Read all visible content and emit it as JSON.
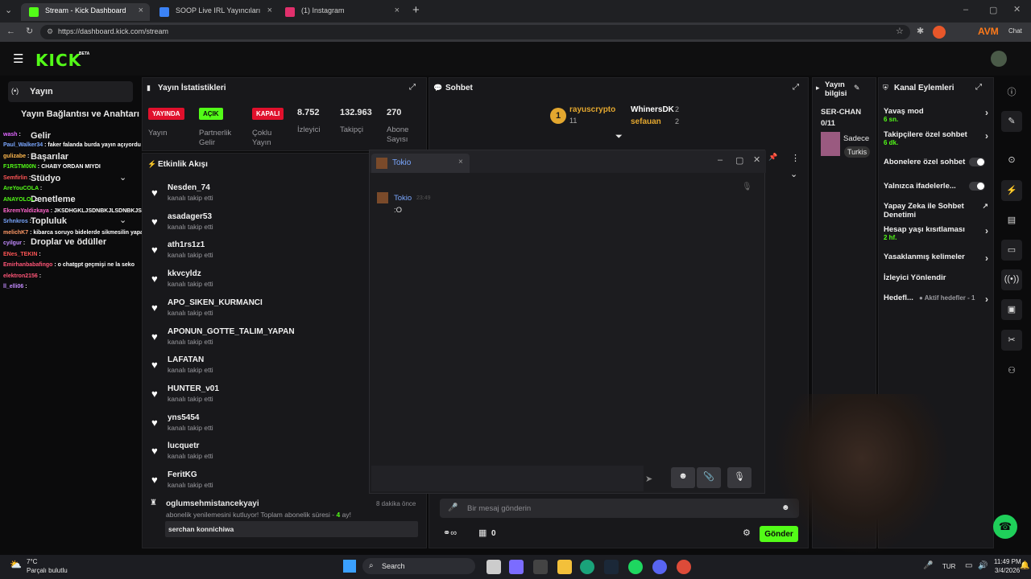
{
  "browser": {
    "tabs": [
      {
        "title": "Stream - Kick Dashboard",
        "color": "#53fc18",
        "active": true
      },
      {
        "title": "SOOP Live IRL Yayıncıları",
        "color": "#3b82f6",
        "active": false
      },
      {
        "title": "(1) Instagram",
        "color": "#e1306c",
        "active": false
      }
    ],
    "url": "https://dashboard.kick.com/stream",
    "ext_label": "AVM",
    "chat_label": "Chat"
  },
  "site": {
    "logo": "KICK",
    "logo_sup": "BETA"
  },
  "sidebar": {
    "title": "Yayın",
    "items": [
      "Yayın Bağlantısı ve Anahtarı",
      "Gelir",
      "Başarılar",
      "Stüdyo",
      "Denetleme",
      "Topluluk",
      "Droplar ve ödüller"
    ]
  },
  "overlay_chat": [
    {
      "user": "wash",
      "msg": "",
      "color": "#e066ff"
    },
    {
      "user": "Paul_Walker34",
      "msg": "faker falanda burda yayın açıyordu galiba",
      "color": "#7aa7ff"
    },
    {
      "user": "gulizabe",
      "msg": "",
      "color": "#ffb84d"
    },
    {
      "user": "F1RSTM00N",
      "msg": "CHABY ORDAN MIYDI",
      "color": "#53fc18"
    },
    {
      "user": "Semfirlin",
      "msg": "",
      "color": "#ff5555"
    },
    {
      "user": "AreYouCOLA",
      "msg": "",
      "color": "#53fc18"
    },
    {
      "user": "ANAYOLOL",
      "msg": "",
      "color": "#53fc18"
    },
    {
      "user": "EkremYaldizkaya",
      "msg": "JKSDHGKLJSDNBKJLSDNBKJSDBNSDKB",
      "color": "#ff66cc"
    },
    {
      "user": "Srhnkros",
      "msg": "",
      "color": "#7aa7ff"
    },
    {
      "user": "melichK7",
      "msg": "kibarca soruyo bidelerde sikmesilin yapay zeka diyerr",
      "color": "#ff9966"
    },
    {
      "user": "cyilgur",
      "msg": "",
      "color": "#c38bff"
    },
    {
      "user": "ENes_TEKIN",
      "msg": "",
      "color": "#ff5555"
    },
    {
      "user": "Emirhanbabafingo",
      "msg": "o chatgpt geçmişi ne la seko",
      "color": "#ff5577"
    },
    {
      "user": "elektron2156",
      "msg": "",
      "color": "#ff5577"
    },
    {
      "user": "ll_elli06",
      "msg": "",
      "color": "#c38bff"
    }
  ],
  "stats": {
    "title": "Yayın İstatistikleri",
    "items": [
      {
        "value": "YAYINDA",
        "label": "Yayın",
        "color": "#e0102c"
      },
      {
        "value": "AÇIK",
        "label": "Partnerlik Gelir",
        "color": "#53fc18"
      },
      {
        "value": "KAPALI",
        "label": "Çoklu Yayın",
        "color": "#e0102c"
      },
      {
        "value": "8.752",
        "label": "İzleyici"
      },
      {
        "value": "132.963",
        "label": "Takipçi"
      },
      {
        "value": "270",
        "label": "Abone Sayısı"
      }
    ]
  },
  "activity": {
    "title": "Etkinlik Akışı",
    "sub": "kanalı takip etti",
    "follows": [
      "Nesden_74",
      "asadager53",
      "ath1rs1z1",
      "kkvcyldz",
      "APO_SIKEN_KURMANCI",
      "APONUN_GOTTE_TALIM_YAPAN",
      "LAFATAN",
      "HUNTER_v01",
      "yns5454",
      "lucquetr",
      "FeritKG"
    ],
    "sub_event": {
      "user": "oglumsehmistancekyayi",
      "time": "8 dakika önce",
      "text_pre": "abonelik yenilemesini kutluyor! Toplam abonelik süresi - ",
      "months": "4",
      "text_post": " ay!",
      "message": "serchan konnichiwa"
    }
  },
  "chat": {
    "title": "Sohbet",
    "leaders": [
      {
        "name": "rayuscrypto",
        "count": "11",
        "color": "#e3a72f"
      },
      {
        "name": "WhinersDK",
        "count": "2",
        "color": "#ffffff"
      },
      {
        "name": "sefauan",
        "count": "2",
        "color": "#e3a72f"
      }
    ],
    "rank": "1",
    "placeholder": "Bir mesaj gönderin",
    "send": "Gönder",
    "footer_count": "0"
  },
  "popup": {
    "title": "Tokio",
    "msg_user": "Tokio",
    "msg_time": "23:49",
    "msg_text": ":O"
  },
  "stream_info": {
    "title": "Yayın bilgisi",
    "name": "SER-CHAN",
    "count": "0/11",
    "category1": "Sadece",
    "category2": "Turkis"
  },
  "actions": {
    "title": "Kanal Eylemleri",
    "items": [
      {
        "label": "Yavaş mod",
        "sub": "6 sn.",
        "type": "chevron"
      },
      {
        "label": "Takipçilere özel sohbet",
        "sub": "6 dk.",
        "type": "chevron"
      },
      {
        "label": "Abonelere özel sohbet",
        "sub": "",
        "type": "toggle"
      },
      {
        "label": "Yalnızca ifadelerle...",
        "sub": "",
        "type": "toggle"
      },
      {
        "label": "Yapay Zeka ile Sohbet Denetimi",
        "sub": "",
        "type": "external"
      },
      {
        "label": "Hesap yaşı kısıtlaması",
        "sub": "2 hf.",
        "type": "chevron"
      },
      {
        "label": "Yasaklanmış kelimeler",
        "sub": "",
        "type": "chevron"
      },
      {
        "label": "İzleyici Yönlendir",
        "sub": "",
        "type": "none"
      },
      {
        "label": "Hedefl...",
        "sub": "Aktif hedefler - 1",
        "type": "chevron"
      }
    ]
  },
  "taskbar": {
    "temp": "7°C",
    "weather": "Parçalı bulutlu",
    "search": "Search",
    "lang": "TUR",
    "time": "11:49 PM",
    "date": "3/4/2026"
  }
}
